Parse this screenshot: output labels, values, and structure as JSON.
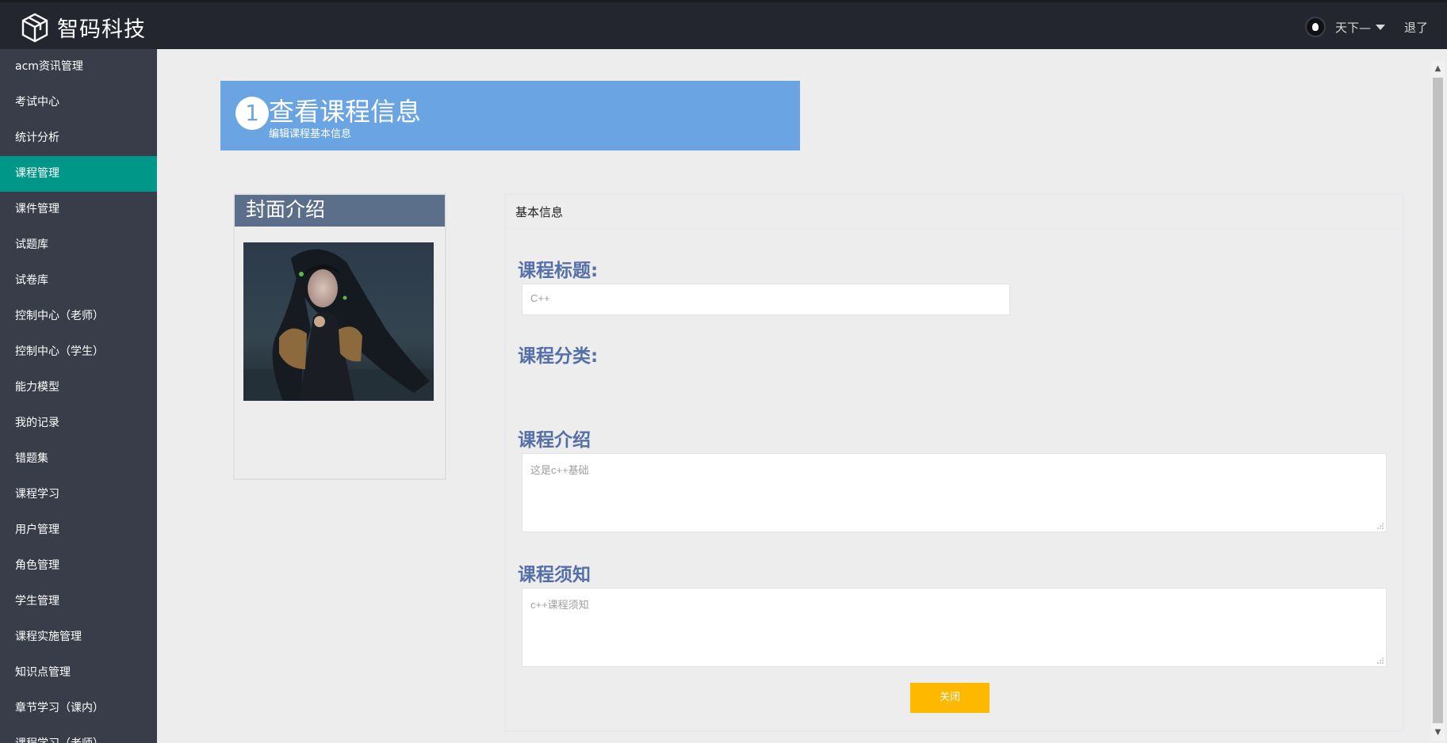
{
  "header": {
    "brand": "智码科技",
    "username": "天下—",
    "logout": "退了"
  },
  "sidebar": {
    "items": [
      {
        "label": "acm资讯管理"
      },
      {
        "label": "考试中心"
      },
      {
        "label": "统计分析"
      },
      {
        "label": "课程管理",
        "active": true
      },
      {
        "label": "课件管理"
      },
      {
        "label": "试题库"
      },
      {
        "label": "试卷库"
      },
      {
        "label": "控制中心（老师）"
      },
      {
        "label": "控制中心（学生）"
      },
      {
        "label": "能力模型"
      },
      {
        "label": "我的记录"
      },
      {
        "label": "错题集"
      },
      {
        "label": "课程学习"
      },
      {
        "label": "用户管理"
      },
      {
        "label": "角色管理"
      },
      {
        "label": "学生管理"
      },
      {
        "label": "课程实施管理"
      },
      {
        "label": "知识点管理"
      },
      {
        "label": "章节学习（课内）"
      },
      {
        "label": "课程学习（老师）"
      }
    ]
  },
  "banner": {
    "step": "1",
    "title": "查看课程信息",
    "subtitle": "编辑课程基本信息"
  },
  "cover": {
    "title": "封面介绍"
  },
  "info": {
    "header": "基本信息",
    "course_title_label": "课程标题:",
    "course_title_value": "C++",
    "category_label": "课程分类:",
    "intro_label": "课程介绍",
    "intro_value": "这是c++基础",
    "notice_label": "课程须知",
    "notice_value": "c++课程须知",
    "close_button": "关闭"
  },
  "colors": {
    "topbar": "#23262e",
    "sidebar": "#393d49",
    "sidebar_active": "#009688",
    "banner": "#6aa4e2",
    "label": "#5570a8",
    "close_button": "#ffb800"
  }
}
